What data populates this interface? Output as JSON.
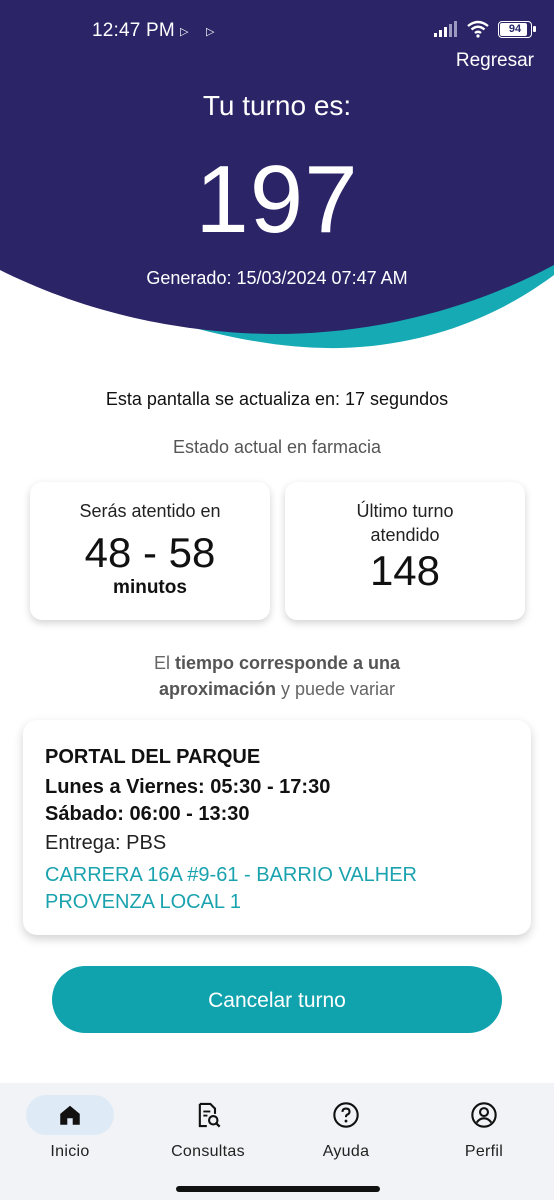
{
  "status_bar": {
    "time": "12:47 PM",
    "battery": "94"
  },
  "header": {
    "back_label": "Regresar",
    "title": "Tu turno es:",
    "turn_number": "197",
    "generated": "Generado: 15/03/2024 07:47 AM"
  },
  "refresh_text": "Esta pantalla se actualiza en: 17 segundos",
  "state_title": "Estado actual en farmacia",
  "wait_card": {
    "label": "Serás atentido en",
    "value": "48 - 58",
    "unit": "minutos"
  },
  "last_turn_card": {
    "label_line1": "Último turno",
    "label_line2": "atendido",
    "value": "148"
  },
  "approx": {
    "part1": "El ",
    "bold1": "tiempo corresponde a una",
    "bold2": "aproximación",
    "part2": " y puede variar"
  },
  "store": {
    "name": "PORTAL DEL PARQUE",
    "weekdays": "Lunes a Viernes: 05:30 - 17:30",
    "saturday": "Sábado: 06:00 - 13:30",
    "delivery": "Entrega: PBS",
    "address": "CARRERA 16A #9-61 - BARRIO VALHER PROVENZA LOCAL 1"
  },
  "cancel_button": "Cancelar turno",
  "nav": [
    {
      "label": "Inicio",
      "icon": "home-icon",
      "active": true
    },
    {
      "label": "Consultas",
      "icon": "search-document-icon",
      "active": false
    },
    {
      "label": "Ayuda",
      "icon": "help-icon",
      "active": false
    },
    {
      "label": "Perfil",
      "icon": "profile-icon",
      "active": false
    }
  ],
  "colors": {
    "header": "#2b2568",
    "accent": "#10a3ad",
    "address": "#1aa3ae"
  }
}
